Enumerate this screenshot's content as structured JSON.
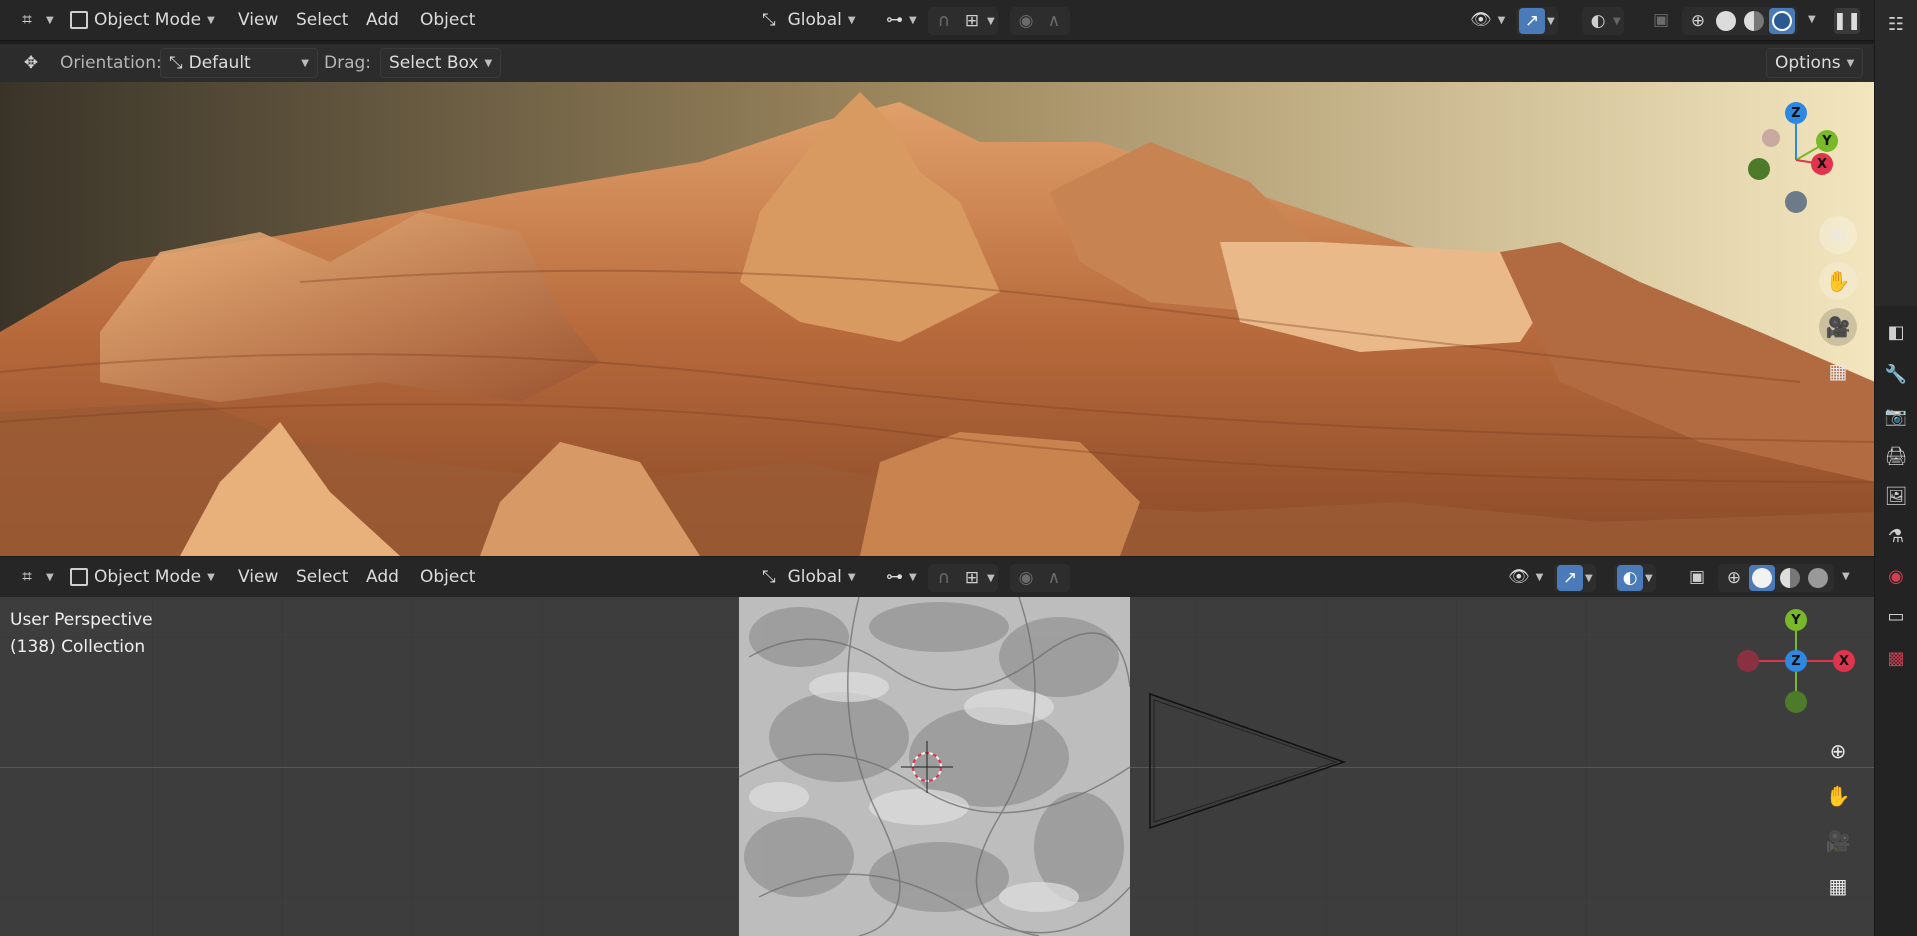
{
  "top_header": {
    "mode": "Object Mode",
    "menus": [
      "View",
      "Select",
      "Add",
      "Object"
    ],
    "orientation": "Global"
  },
  "tool_settings": {
    "orientation_label": "Orientation:",
    "orientation_value": "Default",
    "drag_label": "Drag:",
    "drag_value": "Select Box",
    "options_label": "Options"
  },
  "bottom_header": {
    "mode": "Object Mode",
    "menus": [
      "View",
      "Select",
      "Add",
      "Object"
    ],
    "orientation": "Global"
  },
  "bottom_viewport": {
    "view_name": "User Perspective",
    "collection": "(138) Collection"
  },
  "gizmo_top": {
    "z": "Z",
    "y": "Y",
    "x": "X"
  },
  "gizmo_bottom": {
    "z": "Z",
    "y": "Y",
    "x": "X"
  },
  "colors": {
    "accent": "#4a7ab8",
    "axis_x": "#e0334d",
    "axis_y": "#79b829",
    "axis_z": "#2e87e0"
  },
  "icons": {
    "editor_type": "editor-type-icon",
    "object_mode": "object-mode-icon",
    "transform": "transform-orientation-icon",
    "pivot": "pivot-icon",
    "snap": "snap-icon",
    "proportional": "proportional-edit-icon",
    "visibility": "visibility-icon",
    "gizmo": "gizmo-icon",
    "overlay": "overlay-icon",
    "xray": "xray-icon",
    "zoom": "zoom-icon",
    "pan": "pan-hand-icon",
    "camera": "camera-icon",
    "grid": "perspective-grid-icon"
  }
}
